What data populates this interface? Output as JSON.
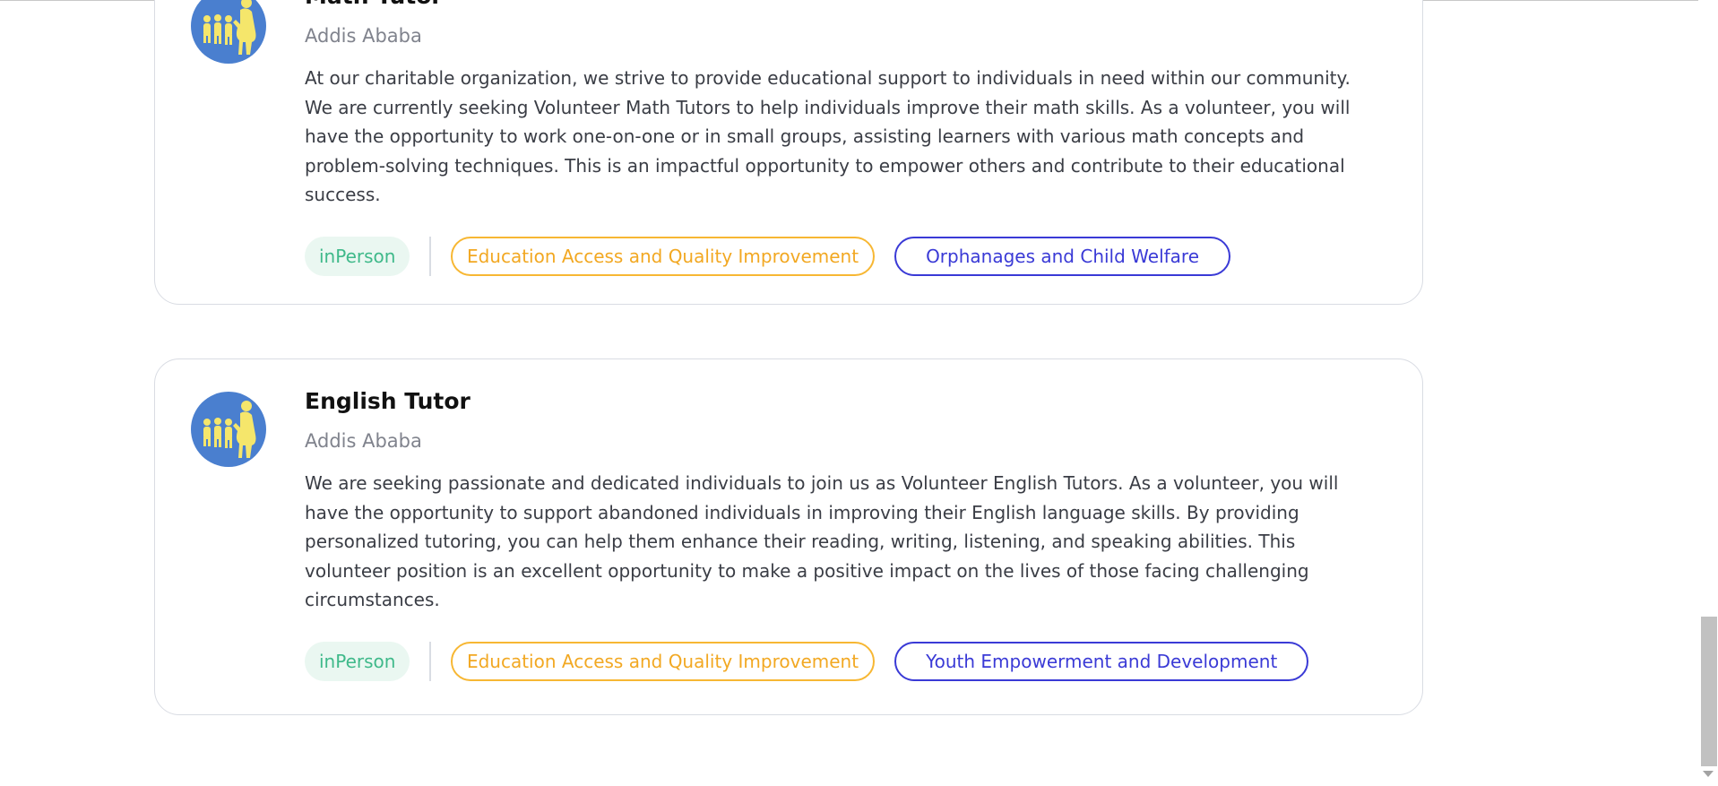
{
  "listings": [
    {
      "title": "Math Tutor",
      "location": "Addis Ababa",
      "description": "At our charitable organization, we strive to provide educational support to individuals in need within our community. We are currently seeking Volunteer Math Tutors to help individuals improve their math skills. As a volunteer, you will have the opportunity to work one-on-one or in small groups, assisting learners with various math concepts and problem-solving techniques. This is an impactful opportunity to empower others and contribute to their educational success.",
      "mode_tag": "inPerson",
      "tags": [
        "Education Access and Quality Improvement",
        "Orphanages and Child Welfare"
      ],
      "avatar_icon": "family-silhouette-icon"
    },
    {
      "title": "English Tutor",
      "location": "Addis Ababa",
      "description": "We are seeking passionate and dedicated individuals to join us as Volunteer English Tutors. As a volunteer, you will have the opportunity to support abandoned individuals in improving their English language skills. By providing personalized tutoring, you can help them enhance their reading, writing, listening, and speaking abilities. This volunteer position is an excellent opportunity to make a positive impact on the lives of those facing challenging circumstances.",
      "mode_tag": "inPerson",
      "tags": [
        "Education Access and Quality Improvement",
        "Youth Empowerment and Development"
      ],
      "avatar_icon": "family-silhouette-icon"
    }
  ],
  "colors": {
    "avatar_bg": "#4a7fcf",
    "avatar_figures": "#f5e66b",
    "mode_tag_bg": "#eaf7f1",
    "mode_tag_text": "#3fb98a",
    "yellow_tag": "#f7b733",
    "blue_tag": "#3a3ad6",
    "card_border": "#d9dce3"
  }
}
